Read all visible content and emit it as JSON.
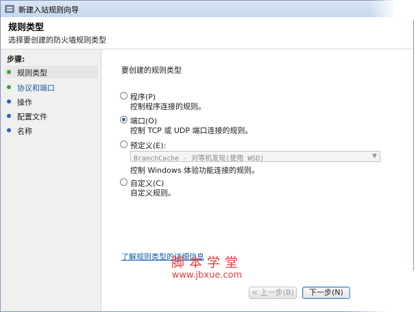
{
  "window": {
    "title": "新建入站规则向导",
    "icon": "firewall-icon"
  },
  "header": {
    "title": "规则类型",
    "subtitle": "选择要创建的防火墙规则类型"
  },
  "sidebar": {
    "label": "步骤:",
    "items": [
      {
        "label": "规则类型",
        "color": "#3aa33a",
        "active": true
      },
      {
        "label": "协议和端口",
        "color": "#3aa33a",
        "active": false
      },
      {
        "label": "操作",
        "color": "#2f5fb8",
        "active": false
      },
      {
        "label": "配置文件",
        "color": "#2f5fb8",
        "active": false
      },
      {
        "label": "名称",
        "color": "#2f5fb8",
        "active": false
      }
    ]
  },
  "main": {
    "question": "要创建的规则类型",
    "options": [
      {
        "label": "程序(P)",
        "desc": "控制程序连接的规则。",
        "checked": false
      },
      {
        "label": "端口(O)",
        "desc": "控制 TCP 或 UDP 端口连接的规则。",
        "checked": true
      },
      {
        "label": "预定义(E):",
        "desc": "控制 Windows 体验功能连接的规则。",
        "checked": false,
        "combo_value": "BranchCache - 对等机发现(使用 WSD)"
      },
      {
        "label": "自定义(C)",
        "desc": "自定义规则。",
        "checked": false
      }
    ],
    "learn_more": "了解规则类型的详细信息"
  },
  "buttons": {
    "back": "< 上一步(B)",
    "next": "下一步(N)"
  },
  "watermark": {
    "cn": "脚本学堂",
    "url": "www.jbxue.com"
  }
}
